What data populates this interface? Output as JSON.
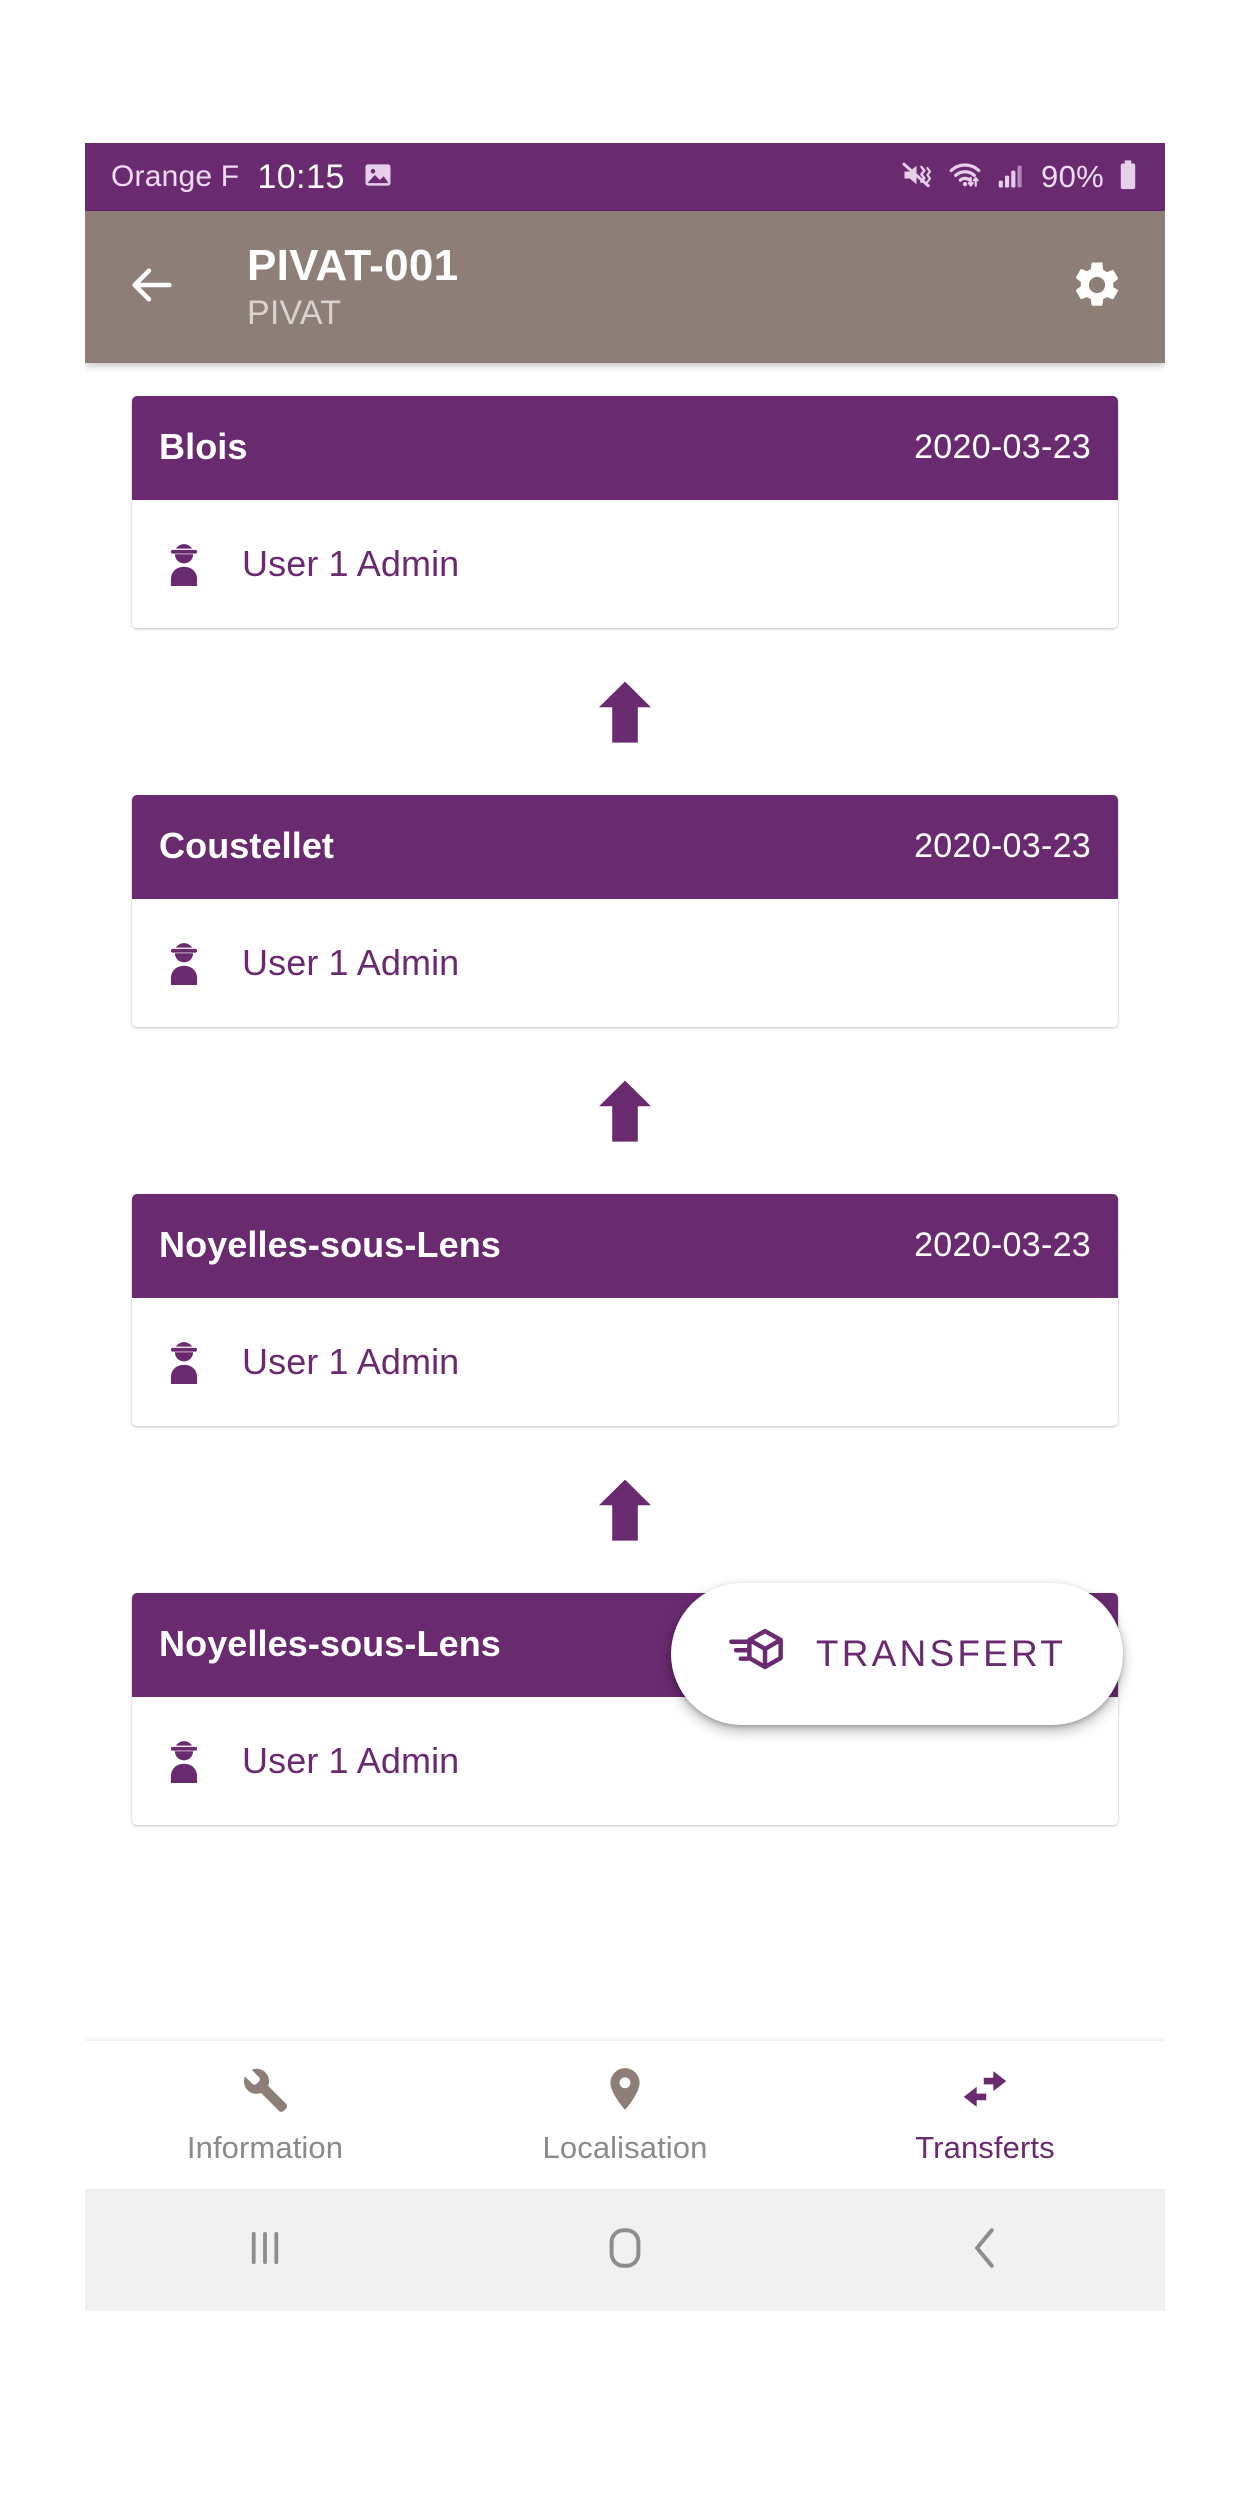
{
  "status_bar": {
    "carrier": "Orange F",
    "time": "10:15",
    "battery_percent": "90%",
    "icons": [
      "image-icon",
      "mute-vibrate-icon",
      "wifi-icon",
      "signal-icon",
      "battery-icon"
    ],
    "background_color": "#6a2a70"
  },
  "app_bar": {
    "title": "PIVAT-001",
    "subtitle": "PIVAT",
    "back_icon": "arrow-left-icon",
    "settings_icon": "gear-icon",
    "background_color": "#8d7f78"
  },
  "transfers": [
    {
      "place": "Blois",
      "date": "2020-03-23",
      "user": "User 1 Admin",
      "user_icon": "worker-helmet-icon"
    },
    {
      "place": "Coustellet",
      "date": "2020-03-23",
      "user": "User 1 Admin",
      "user_icon": "worker-helmet-icon"
    },
    {
      "place": "Noyelles-sous-Lens",
      "date": "2020-03-23",
      "user": "User 1 Admin",
      "user_icon": "worker-helmet-icon"
    },
    {
      "place": "Noyelles-sous-Lens",
      "date": "2020-03-23",
      "user": "User 1 Admin",
      "user_icon": "worker-helmet-icon"
    }
  ],
  "connector": {
    "icon": "arrow-up-icon",
    "color": "#6a2a70"
  },
  "fab": {
    "label": "TRANSFERT",
    "icon": "package-transfer-icon",
    "text_color": "#6a2a70",
    "background_color": "#ffffff"
  },
  "bottom_nav": {
    "active_color": "#6a2a70",
    "inactive_color": "#8a8a8a",
    "items": [
      {
        "label": "Information",
        "icon": "wrench-icon",
        "active": false
      },
      {
        "label": "Localisation",
        "icon": "map-pin-icon",
        "active": false
      },
      {
        "label": "Transferts",
        "icon": "compare-arrows-icon",
        "active": true
      }
    ]
  },
  "system_nav": {
    "items": [
      {
        "icon": "recent-apps-icon"
      },
      {
        "icon": "home-icon"
      },
      {
        "icon": "back-chevron-icon"
      }
    ]
  },
  "theme": {
    "primary": "#6a2a70",
    "app_bar": "#8d7f78",
    "surface": "#ffffff"
  }
}
